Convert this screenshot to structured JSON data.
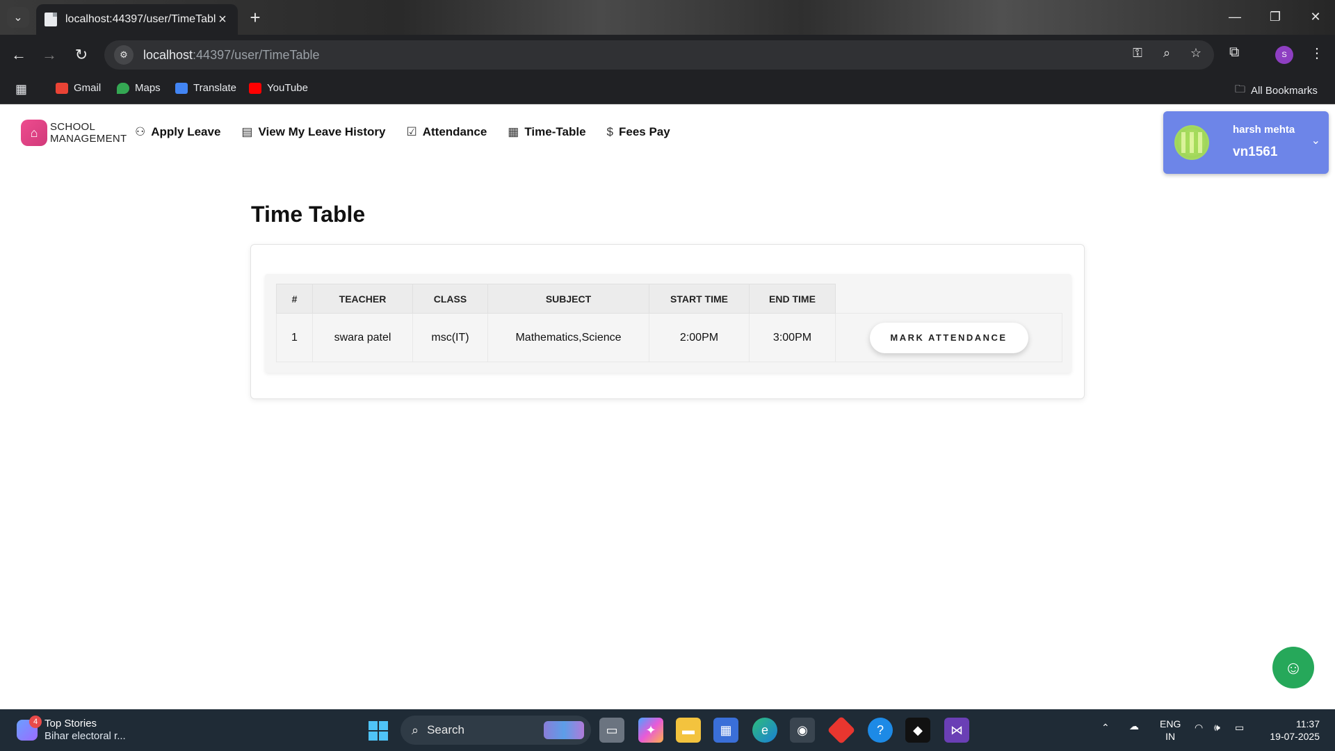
{
  "browser": {
    "tab_title": "localhost:44397/user/TimeTable",
    "url_host": "localhost",
    "url_path": ":44397/user/TimeTable",
    "profile_initial": "S",
    "bookmarks": [
      "Gmail",
      "Maps",
      "Translate",
      "YouTube"
    ],
    "all_bookmarks": "All Bookmarks"
  },
  "nav": {
    "brand_line1": "SCHOOL",
    "brand_line2": "MANAGEMENT",
    "items": [
      {
        "label": "Apply Leave",
        "icon": "user-icon"
      },
      {
        "label": "View My Leave History",
        "icon": "document-icon"
      },
      {
        "label": "Attendance",
        "icon": "checkbox-icon"
      },
      {
        "label": "Time-Table",
        "icon": "calendar-icon"
      },
      {
        "label": "Fees Pay",
        "icon": "dollar-icon"
      }
    ]
  },
  "user": {
    "name": "harsh mehta",
    "id": "vn1561"
  },
  "main": {
    "title": "Time Table",
    "table": {
      "headers": [
        "#",
        "TEACHER",
        "CLASS",
        "SUBJECT",
        "START TIME",
        "END TIME"
      ],
      "rows": [
        {
          "num": "1",
          "teacher": "swara patel",
          "class": "msc(IT)",
          "subject": "Mathematics,Science",
          "start": "2:00PM",
          "end": "3:00PM",
          "action": "MARK ATTENDANCE"
        }
      ]
    }
  },
  "taskbar": {
    "news_badge": "4",
    "news_title": "Top Stories",
    "news_sub": "Bihar electoral r...",
    "search_label": "Search",
    "lang_line1": "ENG",
    "lang_line2": "IN",
    "time": "11:37",
    "date": "19-07-2025"
  },
  "colors": {
    "user_card": "#6d85e8",
    "brand_logo": "#e04a87",
    "chatbot": "#26a85a",
    "browser_chrome": "#202124",
    "taskbar": "#1f2b36"
  }
}
